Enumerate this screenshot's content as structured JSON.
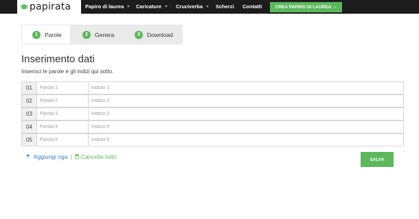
{
  "brand": {
    "logo_text": "papirata"
  },
  "nav": {
    "items": [
      {
        "label": "Papiro di laurea",
        "has_dropdown": true
      },
      {
        "label": "Caricature",
        "has_dropdown": true
      },
      {
        "label": "Cruciverba",
        "has_dropdown": true
      },
      {
        "label": "Scherzi",
        "has_dropdown": false
      },
      {
        "label": "Contatti",
        "has_dropdown": false
      }
    ],
    "cta_label": "CREA PAPIRO DI LAUREA →"
  },
  "steps": [
    {
      "number": "1",
      "label": "Parole",
      "active": true
    },
    {
      "number": "2",
      "label": "Genera",
      "active": false
    },
    {
      "number": "3",
      "label": "Download",
      "active": false
    }
  ],
  "form": {
    "title": "Inserimento dati",
    "subtitle": "Inserisci le parole e gli indizi qui sotto.",
    "rows": [
      {
        "number": "01",
        "word_placeholder": "Parola 1",
        "clue_placeholder": "Indizio 1"
      },
      {
        "number": "02",
        "word_placeholder": "Parola 2",
        "clue_placeholder": "Indizio 2"
      },
      {
        "number": "03",
        "word_placeholder": "Parola 3",
        "clue_placeholder": "Indizio 3"
      },
      {
        "number": "04",
        "word_placeholder": "Parola 4",
        "clue_placeholder": "Indizio 4"
      },
      {
        "number": "05",
        "word_placeholder": "Parola 5",
        "clue_placeholder": "Indizio 5"
      }
    ],
    "add_row_label": "Aggiungi riga",
    "separator": "|",
    "clear_all_label": "Cancella tutto",
    "save_label": "SALVA"
  },
  "colors": {
    "topbar": "#1c1c1c",
    "accent_green": "#5cb85c",
    "link_blue": "#3a7bc8",
    "steps_bg": "#eaeaea"
  },
  "icons": {
    "logo": "graduation-cap-icon",
    "add": "plus-icon",
    "clear": "trash-icon",
    "dropdown": "caret-down-icon"
  }
}
